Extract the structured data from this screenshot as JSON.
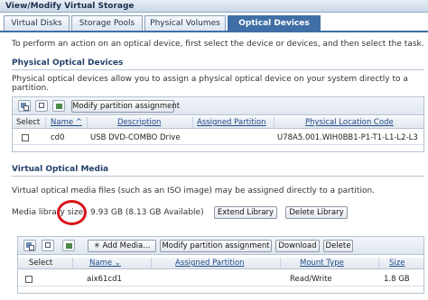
{
  "window": {
    "title": "View/Modify Virtual Storage"
  },
  "tabs": [
    {
      "label": "Virtual Disks",
      "active": false
    },
    {
      "label": "Storage Pools",
      "active": false
    },
    {
      "label": "Physical Volumes",
      "active": false
    },
    {
      "label": "Optical Devices",
      "active": true
    }
  ],
  "instructions": "To perform an action on an optical device, first select the device or devices, and then select the task.",
  "physical": {
    "title": "Physical Optical Devices",
    "description": "Physical optical devices allow you to assign a physical optical device on your system directly to a partition.",
    "toolbar_icons": [
      "select-all-icon",
      "deselect-all-icon",
      "refresh-icon"
    ],
    "button_modify": "Modify partition assignment",
    "columns": [
      "Select",
      "Name ^",
      "Description",
      "Assigned Partition",
      "Physical Location Code"
    ],
    "rows": [
      {
        "name": "cd0",
        "description": "USB DVD-COMBO Drive",
        "assigned_partition": "",
        "location_code": "U78A5.001.WIH0BB1-P1-T1-L1-L2-L3"
      }
    ]
  },
  "media": {
    "title": "Virtual Optical Media",
    "description": "Virtual optical media files (such as an ISO image) may be assigned directly to a partition.",
    "library_label": "Media library size:",
    "library_value": "9.93 GB (8.13 GB Available)",
    "button_extend": "Extend Library",
    "button_delete_library": "Delete Library",
    "toolbar_icons": [
      "select-all-icon",
      "deselect-all-icon",
      "refresh-icon"
    ],
    "button_add": "✳ Add Media...",
    "button_modify": "Modify partition assignment",
    "button_download": "Download",
    "button_delete": "Delete",
    "columns": [
      "Select",
      "Name ⌄",
      "Assigned Partition",
      "Mount Type",
      "Size"
    ],
    "rows": [
      {
        "name": "aix61cd1",
        "assigned_partition": "",
        "mount_type": "Read/Write",
        "size": "1.8 GB"
      }
    ]
  },
  "colors": {
    "accent": "#3f6fa6",
    "link": "#214b86",
    "highlight_circle": "#d7141a"
  }
}
